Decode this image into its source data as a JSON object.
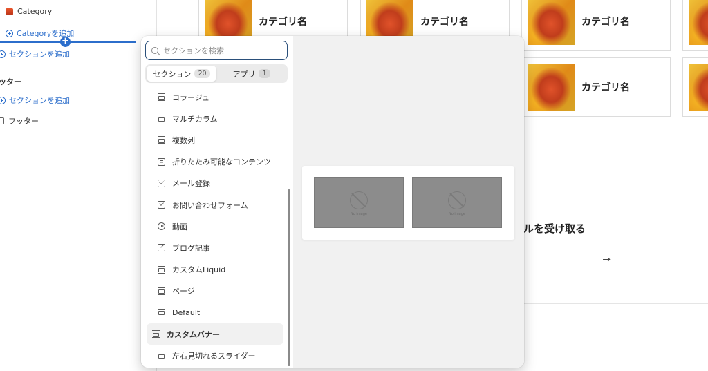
{
  "sidebar": {
    "category_label": "Category",
    "add_category_label": "Categoryを追加",
    "add_section_label": "セクションを追加",
    "footer_group_label": "ッター",
    "footer_add_section_label": "セクションを追加",
    "footer_item_label": "フッター",
    "insert_marker": "+"
  },
  "preview": {
    "cards": [
      {
        "label": "カテゴリ名"
      },
      {
        "label": "カテゴリ名"
      },
      {
        "label": "カテゴリ名"
      },
      {
        "label": "カテゴリ名"
      }
    ],
    "newsletter_title": "ルを受け取る",
    "newsletter_arrow": "→"
  },
  "picker": {
    "search_placeholder": "セクションを検索",
    "tabs": [
      {
        "label": "セクション",
        "count": "20",
        "active": true
      },
      {
        "label": "アプリ",
        "count": "1",
        "active": false
      }
    ],
    "items": [
      {
        "label": "コラージュ",
        "icon": "section-icon"
      },
      {
        "label": "マルチカラム",
        "icon": "section-icon"
      },
      {
        "label": "複数列",
        "icon": "section-icon"
      },
      {
        "label": "折りたたみ可能なコンテンツ",
        "icon": "document-icon"
      },
      {
        "label": "メール登録",
        "icon": "mail-icon"
      },
      {
        "label": "お問い合わせフォーム",
        "icon": "mail-icon"
      },
      {
        "label": "動画",
        "icon": "play-icon"
      },
      {
        "label": "ブログ記事",
        "icon": "edit-icon"
      },
      {
        "label": "カスタムLiquid",
        "icon": "section-icon"
      },
      {
        "label": "ページ",
        "icon": "section-icon"
      },
      {
        "label": "Default",
        "icon": "section-icon"
      },
      {
        "label": "カスタムバナー",
        "icon": "section-icon",
        "selected": true
      },
      {
        "label": "左右見切れるスライダー",
        "icon": "section-icon"
      }
    ],
    "preview_placeholder_text": "No image"
  }
}
